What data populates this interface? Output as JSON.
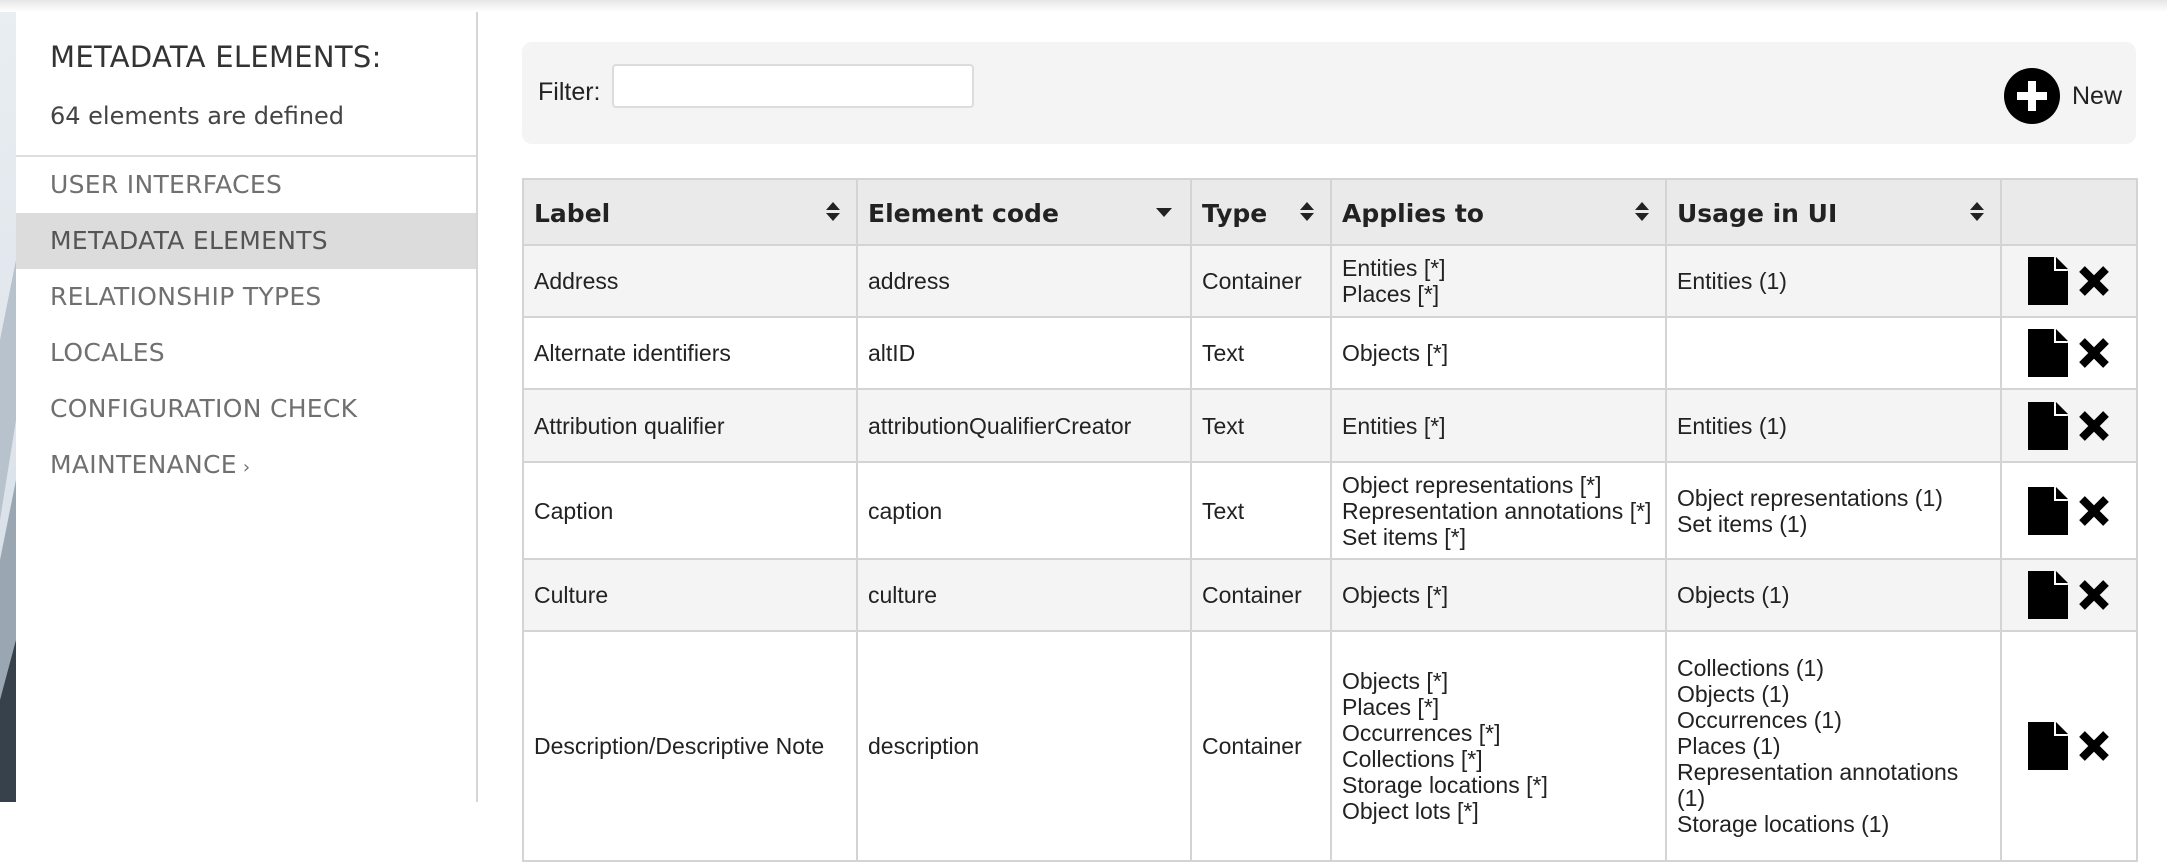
{
  "sidebar": {
    "title": "METADATA ELEMENTS:",
    "subtitle": "64 elements are defined",
    "nav": [
      {
        "label": "USER INTERFACES"
      },
      {
        "label": "METADATA ELEMENTS"
      },
      {
        "label": "RELATIONSHIP TYPES"
      },
      {
        "label": "LOCALES"
      },
      {
        "label": "CONFIGURATION CHECK"
      },
      {
        "label": "MAINTENANCE",
        "suffix": "›"
      }
    ]
  },
  "filter": {
    "label": "Filter:",
    "value": "",
    "placeholder": ""
  },
  "new_button": {
    "label": "New",
    "icon": "plus-circle-icon"
  },
  "table": {
    "headers": [
      "Label",
      "Element code",
      "Type",
      "Applies to",
      "Usage in UI"
    ],
    "rows": [
      {
        "label": "Address",
        "code": "address",
        "type": "Container",
        "applies": [
          "Entities [*]",
          "Places [*]"
        ],
        "usage": [
          "Entities (1)"
        ]
      },
      {
        "label": "Alternate identifiers",
        "code": "altID",
        "type": "Text",
        "applies": [
          "Objects [*]"
        ],
        "usage": []
      },
      {
        "label": "Attribution qualifier",
        "code": "attributionQualifierCreator",
        "type": "Text",
        "applies": [
          "Entities [*]"
        ],
        "usage": [
          "Entities (1)"
        ]
      },
      {
        "label": "Caption",
        "code": "caption",
        "type": "Text",
        "applies": [
          "Object representations [*]",
          "Representation annotations [*]",
          "Set items [*]"
        ],
        "usage": [
          "Object representations (1)",
          "Set items (1)"
        ]
      },
      {
        "label": "Culture",
        "code": "culture",
        "type": "Container",
        "applies": [
          "Objects [*]"
        ],
        "usage": [
          "Objects (1)"
        ]
      },
      {
        "label": "Description/Descriptive Note",
        "code": "description",
        "type": "Container",
        "applies": [
          "Objects [*]",
          "Places [*]",
          "Occurrences [*]",
          "Collections [*]",
          "Storage locations [*]",
          "Object lots [*]"
        ],
        "usage": [
          "Collections (1)",
          "Objects (1)",
          "Occurrences (1)",
          "Places (1)",
          "Representation annotations",
          "(1)",
          "Storage locations (1)"
        ]
      }
    ]
  }
}
